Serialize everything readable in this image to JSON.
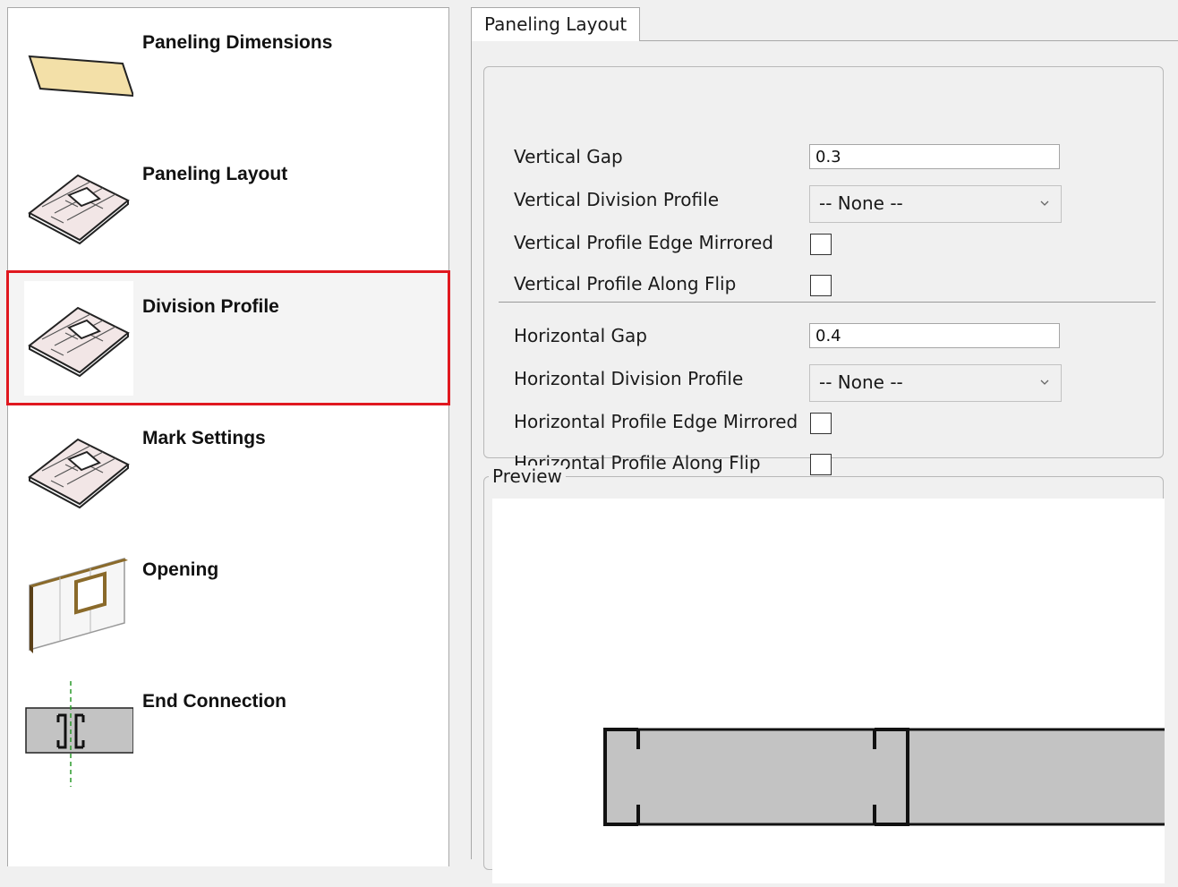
{
  "sidebar": {
    "items": [
      {
        "label": "Paneling Dimensions",
        "icon": "panel-sheet-icon",
        "selected": false
      },
      {
        "label": "Paneling Layout",
        "icon": "brick-panel-icon",
        "selected": false
      },
      {
        "label": "Division Profile",
        "icon": "brick-panel-icon",
        "selected": true
      },
      {
        "label": "Mark Settings",
        "icon": "brick-panel-icon",
        "selected": false
      },
      {
        "label": "Opening",
        "icon": "wall-opening-icon",
        "selected": false
      },
      {
        "label": "End Connection",
        "icon": "end-connection-icon",
        "selected": false
      }
    ]
  },
  "tabs": [
    {
      "label": "Paneling Layout",
      "active": true
    }
  ],
  "form": {
    "vertical_gap": {
      "label": "Vertical Gap",
      "value": "0.3"
    },
    "vertical_division_profile": {
      "label": "Vertical Division Profile",
      "value": "-- None --"
    },
    "vertical_profile_edge_mirrored": {
      "label": "Vertical Profile Edge Mirrored",
      "checked": false
    },
    "vertical_profile_along_flip": {
      "label": "Vertical Profile Along Flip",
      "checked": false
    },
    "horizontal_gap": {
      "label": "Horizontal Gap",
      "value": "0.4"
    },
    "horizontal_division_profile": {
      "label": "Horizontal Division Profile",
      "value": "-- None --"
    },
    "horizontal_profile_edge_mirrored": {
      "label": "Horizontal Profile Edge Mirrored",
      "checked": false
    },
    "horizontal_profile_along_flip": {
      "label": "Horizontal Profile Along Flip",
      "checked": false
    }
  },
  "preview": {
    "label": "Preview"
  },
  "colors": {
    "selection_outline": "#e0181f",
    "panel_fill": "#c3c3c3",
    "sheet_fill": "#f3e0a8",
    "centerline": "#2a9a2a"
  }
}
